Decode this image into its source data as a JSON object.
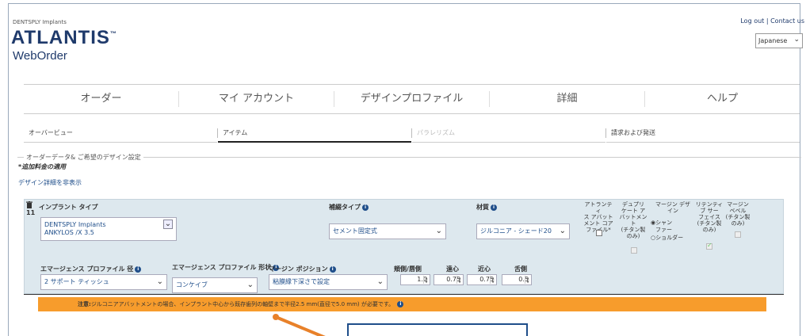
{
  "brand": {
    "company": "DENTSPLY Implants",
    "logo": "ATLANTIS",
    "tm": "™",
    "product": "WebOrder"
  },
  "top_links": {
    "logout": "Log out",
    "separator": "|",
    "contact": "Contact us"
  },
  "language": {
    "selected": "Japanese",
    "icon": "chevron-down-icon"
  },
  "main_nav": [
    {
      "label": "オーダー"
    },
    {
      "label": "マイ アカウント"
    },
    {
      "label": "デザインプロファイル"
    },
    {
      "label": "詳細"
    },
    {
      "label": "ヘルプ"
    }
  ],
  "order_steps": [
    {
      "label": "オーバービュー",
      "state": "normal"
    },
    {
      "label": "アイテム",
      "state": "active"
    },
    {
      "label": "パラレリズム",
      "state": "disabled"
    },
    {
      "label": "請求および発送",
      "state": "normal"
    }
  ],
  "section": {
    "legend": "オーダーデータ& ご希望のデザイン設定",
    "surcharge_note": "*追加料金の適用",
    "toggle_link": "デザイン詳細を非表示"
  },
  "item": {
    "number": "11",
    "implant_type": {
      "label": "インプラント タイプ",
      "value_line1": "DENTSPLY Implants",
      "value_line2": "ANKYLOS /X 3.5"
    },
    "restoration_type": {
      "label": "補綴タイプ",
      "value": "セメント固定式"
    },
    "material": {
      "label": "材質",
      "value": "ジルコニア - シェード20"
    },
    "options": {
      "atlantis_abutment": {
        "label_lines": [
          "アトランティ",
          "ス アバット",
          "メント コア",
          "ファイル*"
        ],
        "checked": false
      },
      "duplicate_abutment": {
        "label_lines": [
          "デュプリ",
          "ケート ア",
          "バットメン",
          "ト",
          "(チタン製",
          "のみ)"
        ],
        "checked": false
      },
      "margin_design": {
        "label_lines": [
          "マージン デザ",
          "イン"
        ],
        "choice1": "シャン",
        "choice1b": "ファー",
        "choice2": "ショルダー",
        "selected": "シャンファー"
      },
      "retention_surface": {
        "label_lines": [
          "リテンティ",
          "ブ サー",
          "フェイス",
          "(チタン製",
          "のみ)"
        ],
        "checked": true
      },
      "margin_bevel": {
        "label_lines": [
          "マージン",
          "ベベル",
          "(チタン製",
          "のみ)"
        ],
        "checked": false
      }
    },
    "emergence_diameter": {
      "label": "エマージェンス プロファイル 径",
      "value": "2 サポート ティッシュ"
    },
    "emergence_shape": {
      "label": "エマージェンス プロファイル 形状",
      "value": "コンケイブ"
    },
    "margin_position": {
      "label": "マージン ポジション",
      "value": "粘膜縁下深さで設定"
    },
    "depths": {
      "buccal_label": "頬側/唇側",
      "distal_label": "遠心",
      "mesial_label": "近心",
      "lingual_label": "舌側",
      "buccal": "1.0",
      "distal": "0.75",
      "mesial": "0.75",
      "lingual": "0.5"
    }
  },
  "notice": {
    "prefix": "注意:",
    "text": "ジルコニアアバットメントの場合、インプラント中心から既存歯列の軸壁まで半径2.5 mm(直径で5.0 mm) が必要です。"
  },
  "colors": {
    "brand": "#1f3a6b",
    "panel": "#dde8ee",
    "notice": "#f79c2c",
    "callout_border": "#1f4e8a"
  }
}
